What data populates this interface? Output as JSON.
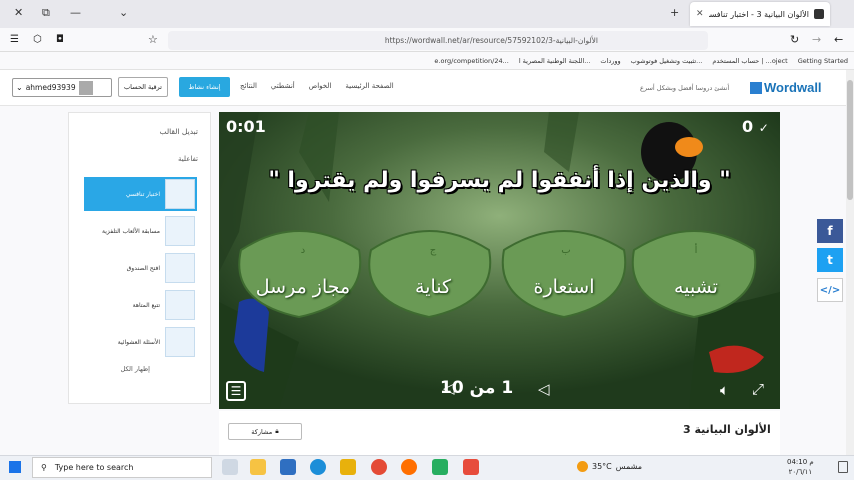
{
  "browser": {
    "tab_title": "الألوان البيانية 3 - اختبار تنافسي",
    "url": "https://wordwall.net/ar/resource/57592102/3-الألوان-البيانية",
    "bookmarks": [
      "Getting Started",
      "حساب المستخدم | ...oject",
      "تثبيت وتشغيل فوتوشوب...",
      "ووردات",
      "اللجنة الوطنية المصرية ا...",
      "e.org/competition/24..."
    ]
  },
  "site": {
    "logo": "Wordwall",
    "tagline": "أنشئ دروسا أفضل وبشكل أسرع",
    "menu": [
      "الصفحة الرئيسية",
      "الخواص",
      "أنشطتي",
      "النتائج"
    ],
    "create_label": "إنشاء نشاط",
    "upgrade_label": "ترقية الحساب",
    "username": "ahmed93939"
  },
  "left_panel": {
    "heading": "تبديل القالب",
    "subheading": "تفاعلية",
    "templates": [
      "اختبار تنافسي",
      "مسابقة الألعاب التلفزية",
      "افتح الصندوق",
      "تتبع المتاهة",
      "الأسئلة العشوائية"
    ],
    "show_all": "إظهار الكل"
  },
  "game": {
    "timer": "0:01",
    "score": "0",
    "question": "\" والذين إذا أنفقوا لم يسرفوا ولم يقتروا \"",
    "answers": [
      {
        "letter": "أ",
        "text": "تشبيه"
      },
      {
        "letter": "ب",
        "text": "استعارة"
      },
      {
        "letter": "ج",
        "text": "كناية"
      },
      {
        "letter": "د",
        "text": "مجاز مرسل"
      }
    ],
    "pager": "1 من 10"
  },
  "activity": {
    "title": "الألوان البيانية 3",
    "share_label": "مشاركة"
  },
  "taskbar": {
    "search_placeholder": "Type here to search",
    "weather": "35°C",
    "weather_label": "مشمس",
    "time": "04:10 م",
    "date": "٢٠/٦/١١"
  }
}
